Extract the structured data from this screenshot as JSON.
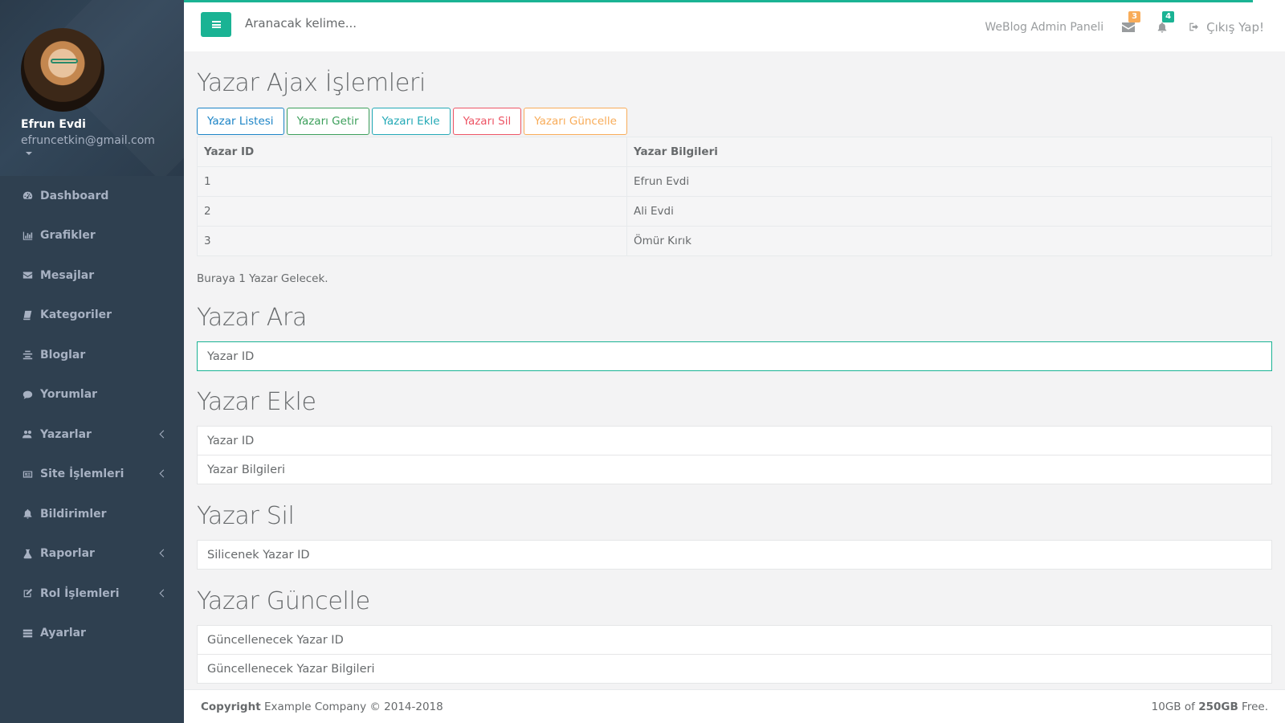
{
  "user": {
    "name": "Efrun Evdi",
    "email": "efruncetkin@gmail.com"
  },
  "sidebar": {
    "items": [
      {
        "label": "Dashboard",
        "icon": "dashboard-icon"
      },
      {
        "label": "Grafikler",
        "icon": "bar-chart-icon"
      },
      {
        "label": "Mesajlar",
        "icon": "envelope-icon"
      },
      {
        "label": "Kategoriler",
        "icon": "book-icon"
      },
      {
        "label": "Bloglar",
        "icon": "align-icon"
      },
      {
        "label": "Yorumlar",
        "icon": "comment-icon"
      },
      {
        "label": "Yazarlar",
        "icon": "users-icon",
        "has_arrow": true
      },
      {
        "label": "Site İşlemleri",
        "icon": "id-card-icon",
        "has_arrow": true
      },
      {
        "label": "Bildirimler",
        "icon": "bell-icon"
      },
      {
        "label": "Raporlar",
        "icon": "flask-icon",
        "has_arrow": true
      },
      {
        "label": "Rol İşlemleri",
        "icon": "edit-icon",
        "has_arrow": true
      },
      {
        "label": "Ayarlar",
        "icon": "list-icon"
      }
    ]
  },
  "topbar": {
    "search_placeholder": "Aranacak kelime...",
    "welcome": "WeBlog Admin Paneli",
    "messages_count": "3",
    "notifications_count": "4",
    "logout": "Çıkış Yap!",
    "accent": "#1ab394"
  },
  "main": {
    "title": "Yazar Ajax İşlemleri",
    "buttons": {
      "list": "Yazar Listesi",
      "get": "Yazarı Getir",
      "add": "Yazarı Ekle",
      "delete": "Yazarı Sil",
      "update": "Yazarı Güncelle"
    },
    "table": {
      "headers": [
        "Yazar ID",
        "Yazar Bilgileri"
      ],
      "rows": [
        [
          "1",
          "Efrun Evdi"
        ],
        [
          "2",
          "Ali Evdi"
        ],
        [
          "3",
          "Ömür Kırık"
        ]
      ]
    },
    "note": "Buraya 1 Yazar Gelecek.",
    "search_section": {
      "title": "Yazar Ara",
      "id_placeholder": "Yazar ID"
    },
    "add_section": {
      "title": "Yazar Ekle",
      "id_placeholder": "Yazar ID",
      "info_placeholder": "Yazar Bilgileri"
    },
    "delete_section": {
      "title": "Yazar Sil",
      "id_placeholder": "Silicenek Yazar ID"
    },
    "update_section": {
      "title": "Yazar Güncelle",
      "id_placeholder": "Güncellenecek Yazar ID",
      "info_placeholder": "Güncellenecek Yazar Bilgileri"
    }
  },
  "footer": {
    "copyright_bold": "Copyright",
    "copyright_text": "Example Company © 2014-2018",
    "storage_used": "10GB of",
    "storage_total": "250GB",
    "storage_suffix": "Free."
  }
}
